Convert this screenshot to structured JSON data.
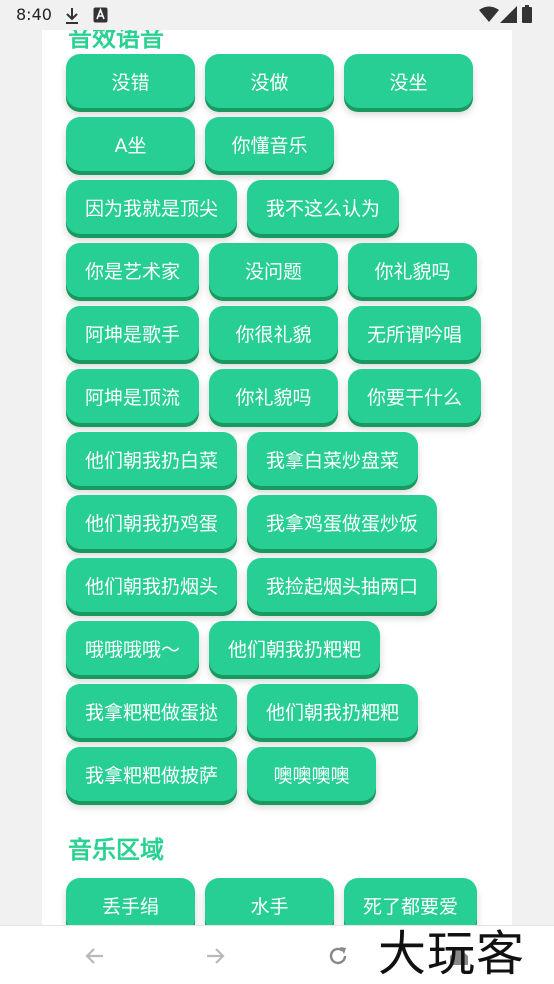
{
  "status_bar": {
    "time": "8:40",
    "icons": [
      "download-icon",
      "keyboard-a-icon",
      "wifi-icon",
      "signal-icon",
      "battery-icon"
    ]
  },
  "section_prev": {
    "title": "音效语音"
  },
  "sound_buttons": [
    "没错",
    "没做",
    "没坐",
    "A坐",
    "你懂音乐",
    "因为我就是顶尖",
    "我不这么认为",
    "你是艺术家",
    "没问题",
    "你礼貌吗",
    "阿坤是歌手",
    "你很礼貌",
    "无所谓吟唱",
    "阿坤是顶流",
    "你礼貌吗",
    "你要干什么",
    "他们朝我扔白菜",
    "我拿白菜炒盘菜",
    "他们朝我扔鸡蛋",
    "我拿鸡蛋做蛋炒饭",
    "他们朝我扔烟头",
    "我捡起烟头抽两口",
    "哦哦哦哦～",
    "他们朝我扔粑粑",
    "我拿粑粑做蛋挞",
    "他们朝我扔粑粑",
    "我拿粑粑做披萨",
    "噢噢噢噢"
  ],
  "section_music": {
    "title": "音乐区域",
    "buttons": [
      "丢手绢",
      "水手",
      "死了都要爱"
    ]
  },
  "nav_bar": {
    "icons": [
      "back-arrow-icon",
      "forward-arrow-icon",
      "refresh-icon",
      "home-icon"
    ]
  },
  "watermark": "大玩客",
  "colors": {
    "accent": "#27cf95",
    "accent_shadow": "#17995f",
    "title": "#2bd192"
  }
}
